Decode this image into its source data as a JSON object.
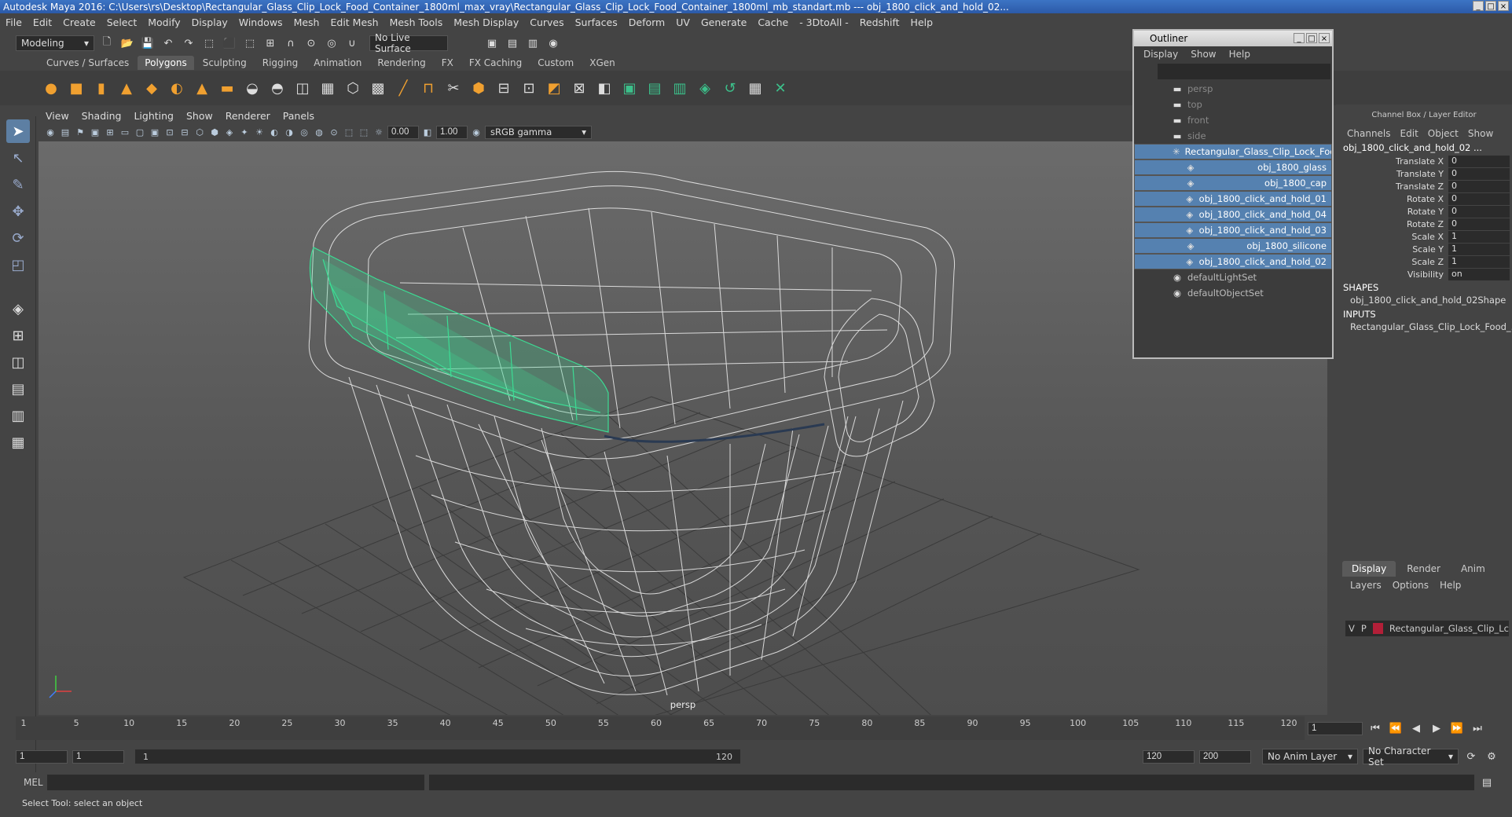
{
  "window": {
    "title": "Autodesk Maya 2016: C:\\Users\\rs\\Desktop\\Rectangular_Glass_Clip_Lock_Food_Container_1800ml_max_vray\\Rectangular_Glass_Clip_Lock_Food_Container_1800ml_mb_standart.mb  ---  obj_1800_click_and_hold_02..."
  },
  "menu": [
    "File",
    "Edit",
    "Create",
    "Select",
    "Modify",
    "Display",
    "Windows",
    "Mesh",
    "Edit Mesh",
    "Mesh Tools",
    "Mesh Display",
    "Curves",
    "Surfaces",
    "Deform",
    "UV",
    "Generate",
    "Cache",
    "- 3DtoAll -",
    "Redshift",
    "Help"
  ],
  "status": {
    "mode": "Modeling",
    "live_surface": "No Live Surface"
  },
  "shelf_tabs": [
    "Curves / Surfaces",
    "Polygons",
    "Sculpting",
    "Rigging",
    "Animation",
    "Rendering",
    "FX",
    "FX Caching",
    "Custom",
    "XGen"
  ],
  "viewport": {
    "menu": [
      "View",
      "Shading",
      "Lighting",
      "Show",
      "Renderer",
      "Panels"
    ],
    "exposure": "0.00",
    "gamma": "1.00",
    "color_space": "sRGB gamma",
    "camera_label": "persp"
  },
  "outliner": {
    "title": "Outliner",
    "menu": [
      "Display",
      "Show",
      "Help"
    ],
    "items": [
      {
        "label": "persp",
        "icon": "camera-icon",
        "dim": true,
        "indent": 0,
        "selected": false
      },
      {
        "label": "top",
        "icon": "camera-icon",
        "dim": true,
        "indent": 0,
        "selected": false
      },
      {
        "label": "front",
        "icon": "camera-icon",
        "dim": true,
        "indent": 0,
        "selected": false
      },
      {
        "label": "side",
        "icon": "camera-icon",
        "dim": true,
        "indent": 0,
        "selected": false
      },
      {
        "label": "Rectangular_Glass_Clip_Lock_Foo",
        "icon": "group-icon",
        "dim": false,
        "indent": 0,
        "selected": true
      },
      {
        "label": "obj_1800_glass",
        "icon": "mesh-icon",
        "dim": false,
        "indent": 1,
        "selected": true
      },
      {
        "label": "obj_1800_cap",
        "icon": "mesh-icon",
        "dim": false,
        "indent": 1,
        "selected": true
      },
      {
        "label": "obj_1800_click_and_hold_01",
        "icon": "mesh-icon",
        "dim": false,
        "indent": 1,
        "selected": true
      },
      {
        "label": "obj_1800_click_and_hold_04",
        "icon": "mesh-icon",
        "dim": false,
        "indent": 1,
        "selected": true
      },
      {
        "label": "obj_1800_click_and_hold_03",
        "icon": "mesh-icon",
        "dim": false,
        "indent": 1,
        "selected": true
      },
      {
        "label": "obj_1800_silicone",
        "icon": "mesh-icon",
        "dim": false,
        "indent": 1,
        "selected": true
      },
      {
        "label": "obj_1800_click_and_hold_02",
        "icon": "mesh-icon",
        "dim": false,
        "indent": 1,
        "selected": true
      },
      {
        "label": "defaultLightSet",
        "icon": "set-icon",
        "dim": false,
        "indent": 0,
        "selected": false
      },
      {
        "label": "defaultObjectSet",
        "icon": "set-icon",
        "dim": false,
        "indent": 0,
        "selected": false
      }
    ]
  },
  "channelbox": {
    "header": "Channel Box / Layer Editor",
    "menu": [
      "Channels",
      "Edit",
      "Object",
      "Show"
    ],
    "object": "obj_1800_click_and_hold_02 ...",
    "attrs": [
      {
        "label": "Translate X",
        "value": "0"
      },
      {
        "label": "Translate Y",
        "value": "0"
      },
      {
        "label": "Translate Z",
        "value": "0"
      },
      {
        "label": "Rotate X",
        "value": "0"
      },
      {
        "label": "Rotate Y",
        "value": "0"
      },
      {
        "label": "Rotate Z",
        "value": "0"
      },
      {
        "label": "Scale X",
        "value": "1"
      },
      {
        "label": "Scale Y",
        "value": "1"
      },
      {
        "label": "Scale Z",
        "value": "1"
      },
      {
        "label": "Visibility",
        "value": "on"
      }
    ],
    "shapes_title": "SHAPES",
    "shape": "obj_1800_click_and_hold_02Shape",
    "inputs_title": "INPUTS",
    "input": "Rectangular_Glass_Clip_Lock_Food_..."
  },
  "layers": {
    "tabs": [
      "Display",
      "Render",
      "Anim"
    ],
    "menu": [
      "Layers",
      "Options",
      "Help"
    ],
    "row": {
      "v": "V",
      "p": "P",
      "name": "Rectangular_Glass_Clip_Lc",
      "color": "#b21f38"
    }
  },
  "timeline": {
    "ticks": [
      "1",
      "5",
      "10",
      "15",
      "20",
      "25",
      "30",
      "35",
      "40",
      "45",
      "50",
      "55",
      "60",
      "65",
      "70",
      "75",
      "80",
      "85",
      "90",
      "95",
      "100",
      "105",
      "110",
      "115",
      "120"
    ],
    "current_frame": "1"
  },
  "range": {
    "start": "1",
    "playback_start": "1",
    "slider_start": "1",
    "slider_end": "120",
    "playback_end": "120",
    "end": "200",
    "anim_layer": "No Anim Layer",
    "char_set": "No Character Set"
  },
  "cmd": {
    "label": "MEL"
  },
  "help": "Select Tool: select an object"
}
